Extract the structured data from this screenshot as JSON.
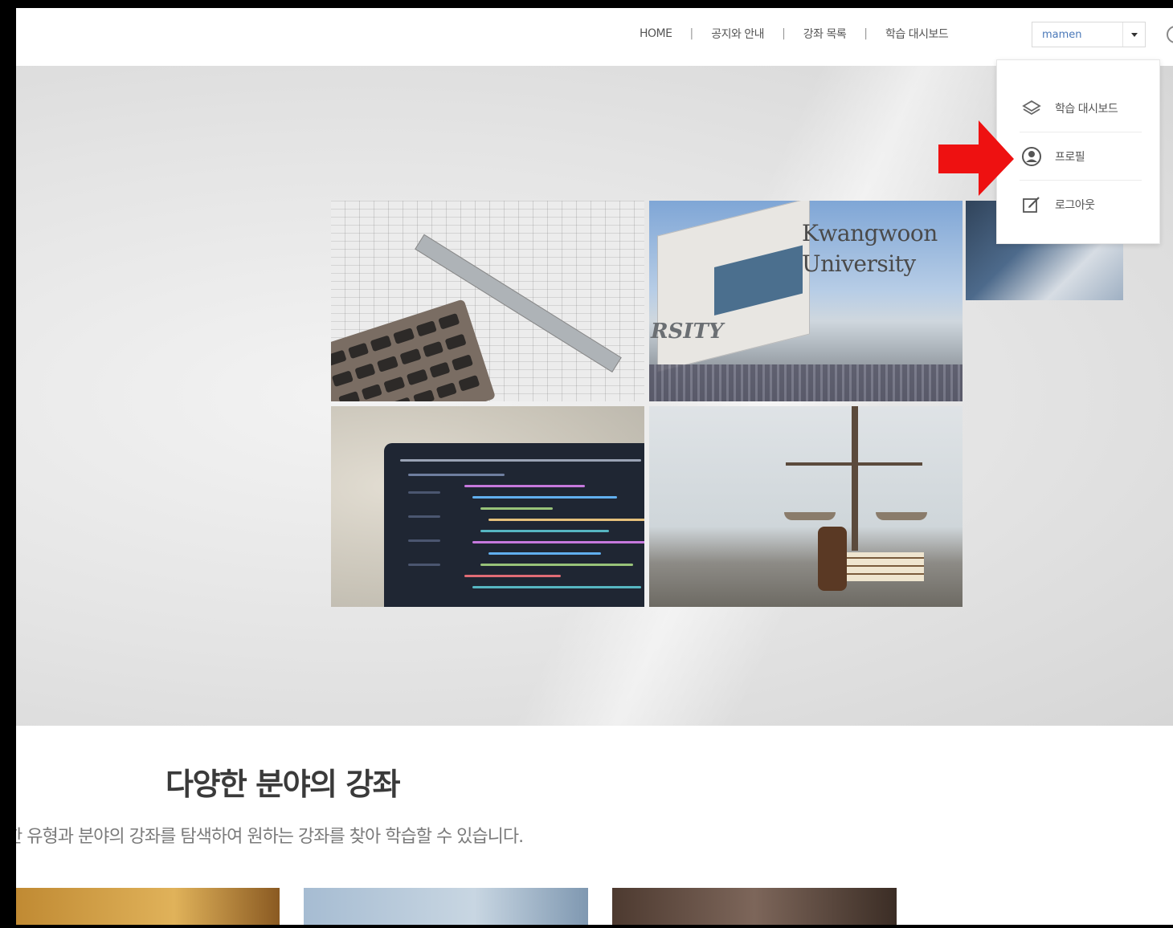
{
  "nav": {
    "items": [
      {
        "label": "HOME"
      },
      {
        "label": "공지와 안내"
      },
      {
        "label": "강좌 목록"
      },
      {
        "label": "학습 대시보드"
      }
    ],
    "separator": "|"
  },
  "user_menu": {
    "username": "mamen",
    "items": [
      {
        "label": "학습 대시보드",
        "icon": "layers-icon"
      },
      {
        "label": "프로필",
        "icon": "user-circle-icon"
      },
      {
        "label": "로그아웃",
        "icon": "edit-icon"
      }
    ]
  },
  "hero": {
    "university_text_line1": "Kwangwoon",
    "university_text_line2": "University",
    "building_sign": "RSITY"
  },
  "section": {
    "title": "다양한 분야의 강좌",
    "description": "한 유형과 분야의 강좌를 탐색하여 원하는 강좌를 찾아 학습할 수 있습니다."
  },
  "annotation": {
    "arrow_color": "#ee1111"
  }
}
